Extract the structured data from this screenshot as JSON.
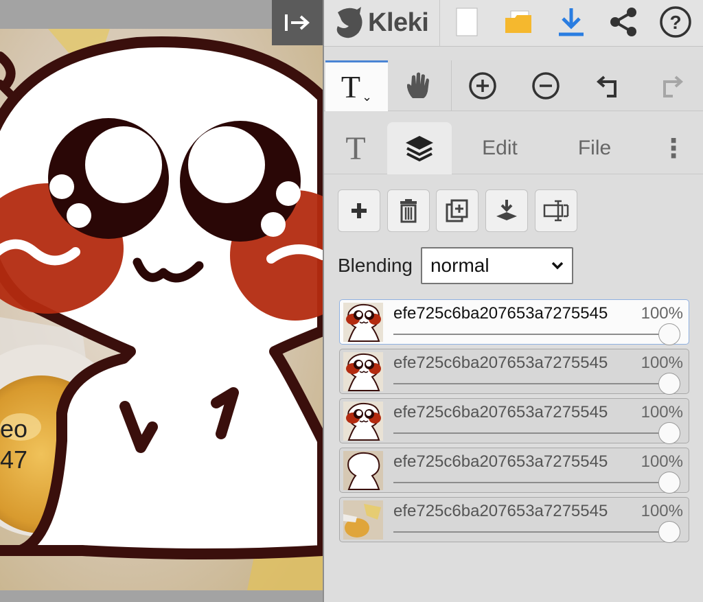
{
  "app": {
    "name": "Kleki"
  },
  "canvas": {
    "photo_text_lines": [
      "eo",
      "47"
    ]
  },
  "toolbar": {
    "icons": [
      "new-document-icon",
      "open-folder-icon",
      "download-icon",
      "share-icon",
      "help-icon"
    ],
    "download_color": "#2a7de1",
    "folder_color": "#f5b82e"
  },
  "tools": {
    "active_tool_glyph": "T",
    "dropdown_glyph": "⌄",
    "icons": [
      "hand-icon",
      "zoom-in-icon",
      "zoom-out-icon",
      "undo-icon",
      "redo-icon"
    ]
  },
  "tabs": {
    "text_glyph": "T",
    "layers_icon": "layers-icon",
    "edit": "Edit",
    "file": "File",
    "more_glyph": "⋮",
    "active": "layers"
  },
  "layers_panel": {
    "buttons": [
      "add-layer",
      "delete-layer",
      "duplicate-layer",
      "merge-down",
      "rename-layer"
    ],
    "blending_label": "Blending",
    "blending_value": "normal",
    "layers": [
      {
        "name": "efe725c6ba207653a7275545",
        "opacity": "100%",
        "opacity_value": 1.0,
        "active": true,
        "thumb": "character-face"
      },
      {
        "name": "efe725c6ba207653a7275545",
        "opacity": "100%",
        "opacity_value": 1.0,
        "active": false,
        "thumb": "character-face"
      },
      {
        "name": "efe725c6ba207653a7275545",
        "opacity": "100%",
        "opacity_value": 1.0,
        "active": false,
        "thumb": "character-face"
      },
      {
        "name": "efe725c6ba207653a7275545",
        "opacity": "100%",
        "opacity_value": 1.0,
        "active": false,
        "thumb": "character-silhouette"
      },
      {
        "name": "efe725c6ba207653a7275545",
        "opacity": "100%",
        "opacity_value": 1.0,
        "active": false,
        "thumb": "photo-background"
      }
    ]
  },
  "colors": {
    "accent": "#4a84d4",
    "panel_bg": "#dddddd",
    "blush": "#b32b10",
    "outline": "#3a0f0c"
  }
}
